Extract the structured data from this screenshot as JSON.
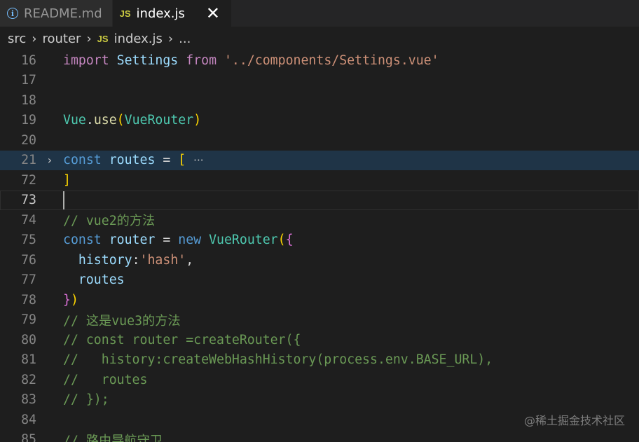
{
  "tabs": [
    {
      "label": "README.md",
      "icon": "info-icon",
      "active": false
    },
    {
      "label": "index.js",
      "icon": "js-icon",
      "active": true
    }
  ],
  "js_badge": "JS",
  "close_glyph": "✕",
  "breadcrumb": {
    "parts": [
      "src",
      "router",
      "index.js",
      "..."
    ]
  },
  "lines": [
    {
      "n": "16"
    },
    {
      "n": "17"
    },
    {
      "n": "18"
    },
    {
      "n": "19"
    },
    {
      "n": "20"
    },
    {
      "n": "21"
    },
    {
      "n": "72"
    },
    {
      "n": "73"
    },
    {
      "n": "74"
    },
    {
      "n": "75"
    },
    {
      "n": "76"
    },
    {
      "n": "77"
    },
    {
      "n": "78"
    },
    {
      "n": "79"
    },
    {
      "n": "80"
    },
    {
      "n": "81"
    },
    {
      "n": "82"
    },
    {
      "n": "83"
    },
    {
      "n": "84"
    },
    {
      "n": "85"
    }
  ],
  "code": {
    "l16": {
      "import": "import",
      "name": "Settings",
      "from": "from",
      "path": "'../components/Settings.vue'"
    },
    "l19": {
      "obj": "Vue",
      "dot": ".",
      "fn": "use",
      "open": "(",
      "arg": "VueRouter",
      "close": ")"
    },
    "l21": {
      "kw": "const",
      "name": "routes",
      "eq": " = ",
      "br": "[",
      "ell": "···"
    },
    "l72": {
      "br": "]"
    },
    "l74": {
      "text": "// vue2的方法"
    },
    "l75": {
      "kw": "const",
      "name": "router",
      "eq": " = ",
      "new": "new",
      "cls": "VueRouter",
      "p": "(",
      "b": "{"
    },
    "l76": {
      "key": "history",
      "colon": ":",
      "val": "'hash'",
      "comma": ","
    },
    "l77": {
      "name": "routes"
    },
    "l78": {
      "b": "}",
      "p": ")"
    },
    "l79": {
      "text": "// 这是vue3的方法"
    },
    "l80": {
      "text": "// const router =createRouter({"
    },
    "l81": {
      "text": "//   history:createWebHashHistory(process.env.BASE_URL),"
    },
    "l82": {
      "text": "//   routes"
    },
    "l83": {
      "text": "// });"
    },
    "l85": {
      "text": "// 路由导航守卫"
    }
  },
  "watermark": "@稀土掘金技术社区",
  "colors": {
    "background": "#1e1e1e",
    "keyword": "#569cd6",
    "string": "#ce9178",
    "comment": "#6a9955",
    "type": "#4ec9b0"
  }
}
